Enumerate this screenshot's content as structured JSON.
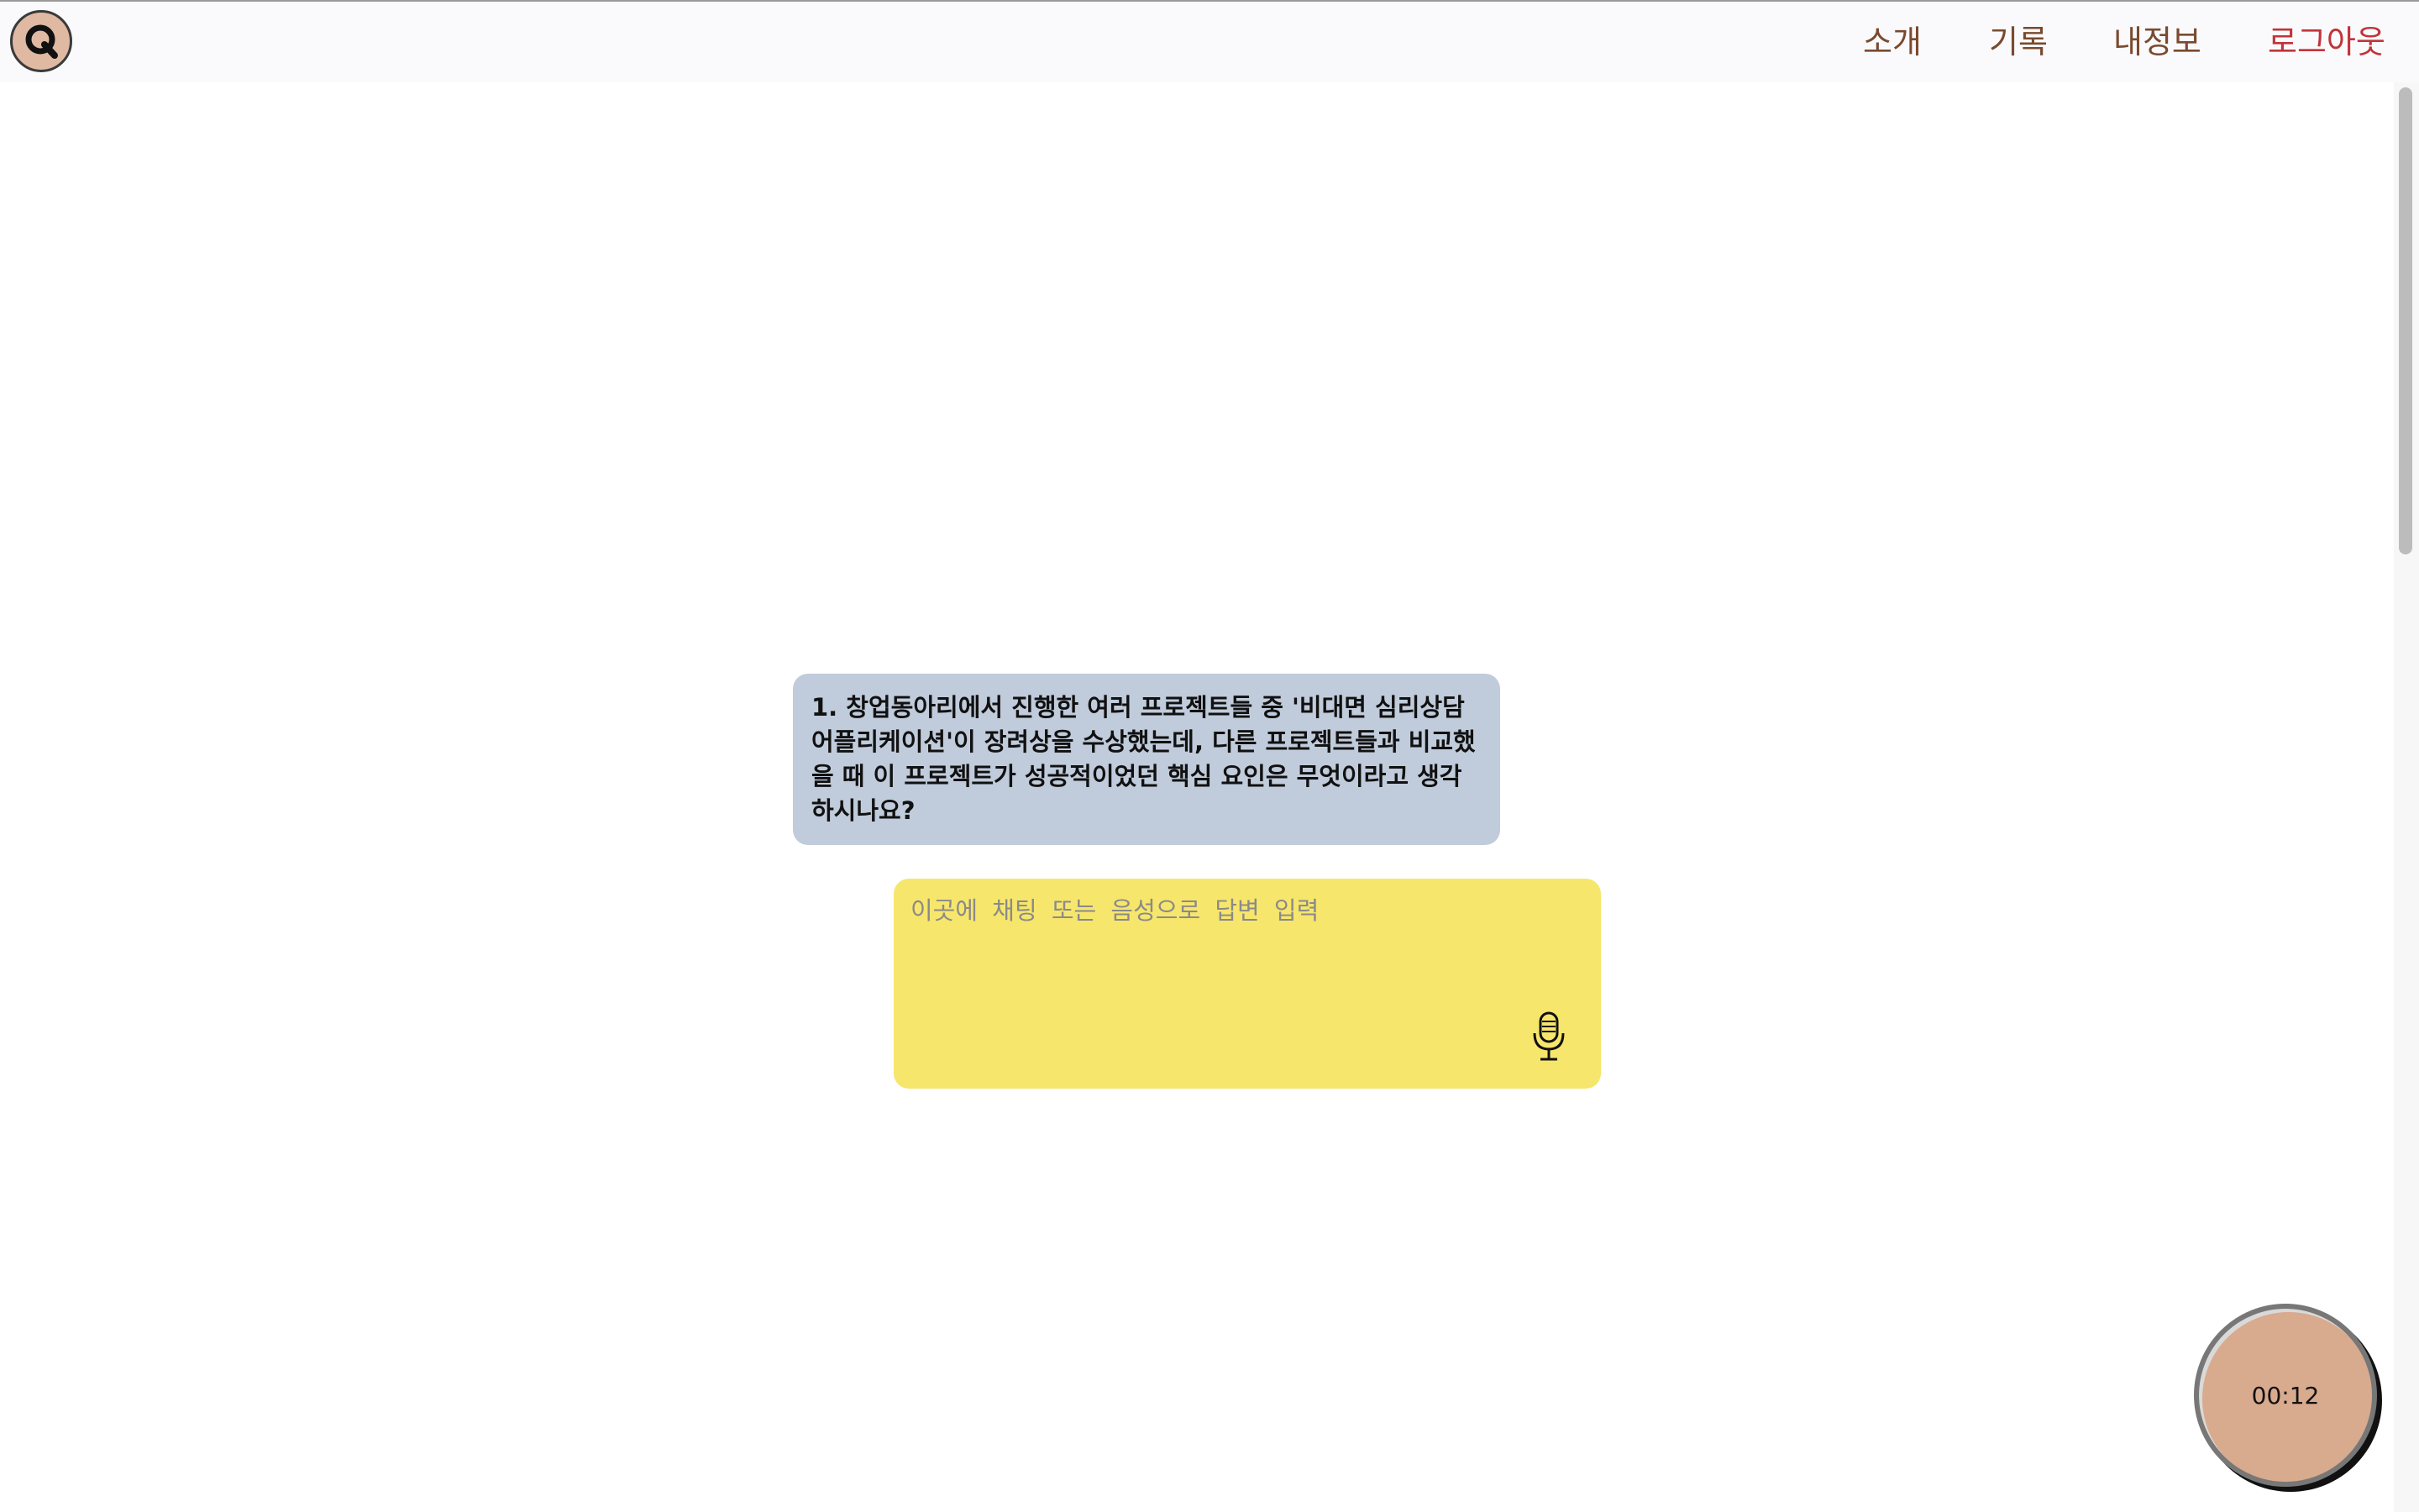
{
  "nav": {
    "logo_letter": "Q",
    "links": [
      {
        "label": "소개"
      },
      {
        "label": "기록"
      },
      {
        "label": "내정보"
      },
      {
        "label": "로그아웃"
      }
    ]
  },
  "question": {
    "text": "1. 창업동아리에서 진행한 여러 프로젝트들 중 '비대면 심리상담 어플리케이션'이 장려상을 수상했는데, 다른 프로젝트들과 비교했을 때 이 프로젝트가 성공적이었던 핵심 요인은 무엇이라고 생각하시나요?"
  },
  "answer": {
    "value": "",
    "placeholder": "이곳에 채팅 또는 음성으로 답변 입력"
  },
  "timer": {
    "value": "00:12"
  },
  "colors": {
    "nav_text": "#7a4a2e",
    "logout_text": "#c0343a",
    "question_bg": "#c0cbdb",
    "answer_bg": "#f7e66c",
    "timer_bg": "#d8aa8e",
    "logo_bg": "#e0b9a3"
  },
  "icons": {
    "logo": "q-logo-icon",
    "mic": "microphone-icon"
  }
}
